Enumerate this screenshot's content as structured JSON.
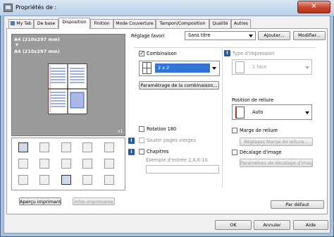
{
  "window": {
    "title": "Propriétés de :",
    "close_label": "✕"
  },
  "tabs": [
    {
      "label": "My Tab"
    },
    {
      "label": "De base"
    },
    {
      "label": "Disposition"
    },
    {
      "label": "Finition"
    },
    {
      "label": "Mode Couverture"
    },
    {
      "label": "Tampon/Composition"
    },
    {
      "label": "Qualité"
    },
    {
      "label": "Autres"
    }
  ],
  "active_tab": "Disposition",
  "header": {
    "favorite_label": "Réglage favori",
    "favorite_value": "Sans titre",
    "add_button": "Ajouter...",
    "modify_button": "Modifier..."
  },
  "preview": {
    "paper_line1": "A4 (210x297 mm)",
    "arrow": "▼",
    "paper_line2": "A4 (210x297 mm)",
    "copies": "x1"
  },
  "bottom_left": {
    "preview_button": "Aperçu imprimante",
    "info_button": "Infos imprimante"
  },
  "combination": {
    "checkbox_label": "Combinaison",
    "checked": true,
    "value": "2 x 2",
    "settings_button": "Paramétrage de la combinaison..."
  },
  "print_type": {
    "label": "Type d'impression",
    "value": "1 face"
  },
  "binding": {
    "label": "Position de reliure",
    "value": "Auto"
  },
  "rotation": {
    "label": "Rotation 180",
    "checked": false
  },
  "skip_blank": {
    "label": "Sauter pages vierges",
    "checked": false
  },
  "chapters": {
    "label": "Chapitres",
    "checked": false,
    "example": "Exemple d'entrée 2,4,6-10"
  },
  "binding_margin": {
    "label": "Marge de reliure",
    "checked": false,
    "button": "Réglages Marge de reliure..."
  },
  "image_shift": {
    "label": "Décalage d'image",
    "checked": false,
    "button": "Paramètres de décalage d'image..."
  },
  "default_button": "Par défaut",
  "footer": {
    "ok": "OK",
    "cancel": "Annuler",
    "help": "Aide"
  }
}
